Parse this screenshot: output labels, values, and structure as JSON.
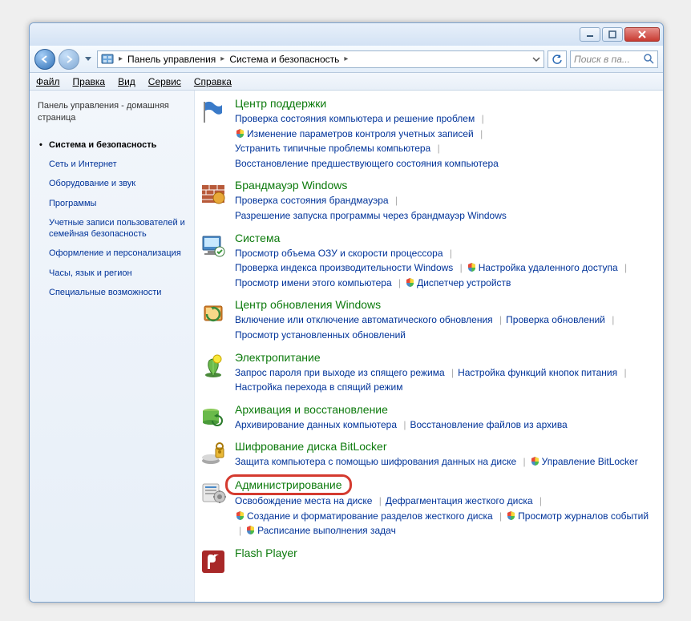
{
  "breadcrumb": {
    "root": "Панель управления",
    "current": "Система и безопасность"
  },
  "search": {
    "placeholder": "Поиск в па..."
  },
  "menu": {
    "file": "Файл",
    "edit": "Правка",
    "view": "Вид",
    "tools": "Сервис",
    "help": "Справка"
  },
  "sidebar": {
    "home": "Панель управления - домашняя страница",
    "items": [
      {
        "label": "Система и безопасность",
        "active": true
      },
      {
        "label": "Сеть и Интернет"
      },
      {
        "label": "Оборудование и звук"
      },
      {
        "label": "Программы"
      },
      {
        "label": "Учетные записи пользователей и семейная безопасность"
      },
      {
        "label": "Оформление и персонализация"
      },
      {
        "label": "Часы, язык и регион"
      },
      {
        "label": "Специальные возможности"
      }
    ]
  },
  "categories": [
    {
      "icon": "flag",
      "title": "Центр поддержки",
      "tasks": [
        {
          "t": "Проверка состояния компьютера и решение проблем"
        },
        {
          "t": "Изменение параметров контроля учетных записей",
          "shield": true
        },
        {
          "t": "Устранить типичные проблемы компьютера"
        },
        {
          "t": "Восстановление предшествующего состояния компьютера"
        }
      ]
    },
    {
      "icon": "wall",
      "title": "Брандмауэр Windows",
      "tasks": [
        {
          "t": "Проверка состояния брандмауэра"
        },
        {
          "t": "Разрешение запуска программы через брандмауэр Windows"
        }
      ]
    },
    {
      "icon": "system",
      "title": "Система",
      "tasks": [
        {
          "t": "Просмотр объема ОЗУ и скорости процессора"
        },
        {
          "t": "Проверка индекса производительности Windows"
        },
        {
          "t": "Настройка удаленного доступа",
          "shield": true
        },
        {
          "t": "Просмотр имени этого компьютера"
        },
        {
          "t": "Диспетчер устройств",
          "shield": true
        }
      ]
    },
    {
      "icon": "update",
      "title": "Центр обновления Windows",
      "tasks": [
        {
          "t": "Включение или отключение автоматического обновления"
        },
        {
          "t": "Проверка обновлений"
        },
        {
          "t": "Просмотр установленных обновлений"
        }
      ]
    },
    {
      "icon": "power",
      "title": "Электропитание",
      "tasks": [
        {
          "t": "Запрос пароля при выходе из спящего режима"
        },
        {
          "t": "Настройка функций кнопок питания"
        },
        {
          "t": "Настройка перехода в спящий режим"
        }
      ]
    },
    {
      "icon": "backup",
      "title": "Архивация и восстановление",
      "tasks": [
        {
          "t": "Архивирование данных компьютера"
        },
        {
          "t": "Восстановление файлов из архива"
        }
      ]
    },
    {
      "icon": "bitlocker",
      "title": "Шифрование диска BitLocker",
      "tasks": [
        {
          "t": "Защита компьютера с помощью шифрования данных на диске"
        },
        {
          "t": "Управление BitLocker",
          "shield": true
        }
      ]
    },
    {
      "icon": "admin",
      "title": "Администрирование",
      "highlight": true,
      "tasks": [
        {
          "t": "Освобождение места на диске"
        },
        {
          "t": "Дефрагментация жесткого диска"
        },
        {
          "t": "Создание и форматирование разделов жесткого диска",
          "shield": true
        },
        {
          "t": "Просмотр журналов событий",
          "shield": true
        },
        {
          "t": "Расписание выполнения задач",
          "shield": true
        }
      ]
    },
    {
      "icon": "flash",
      "title": "Flash Player",
      "tasks": []
    }
  ]
}
